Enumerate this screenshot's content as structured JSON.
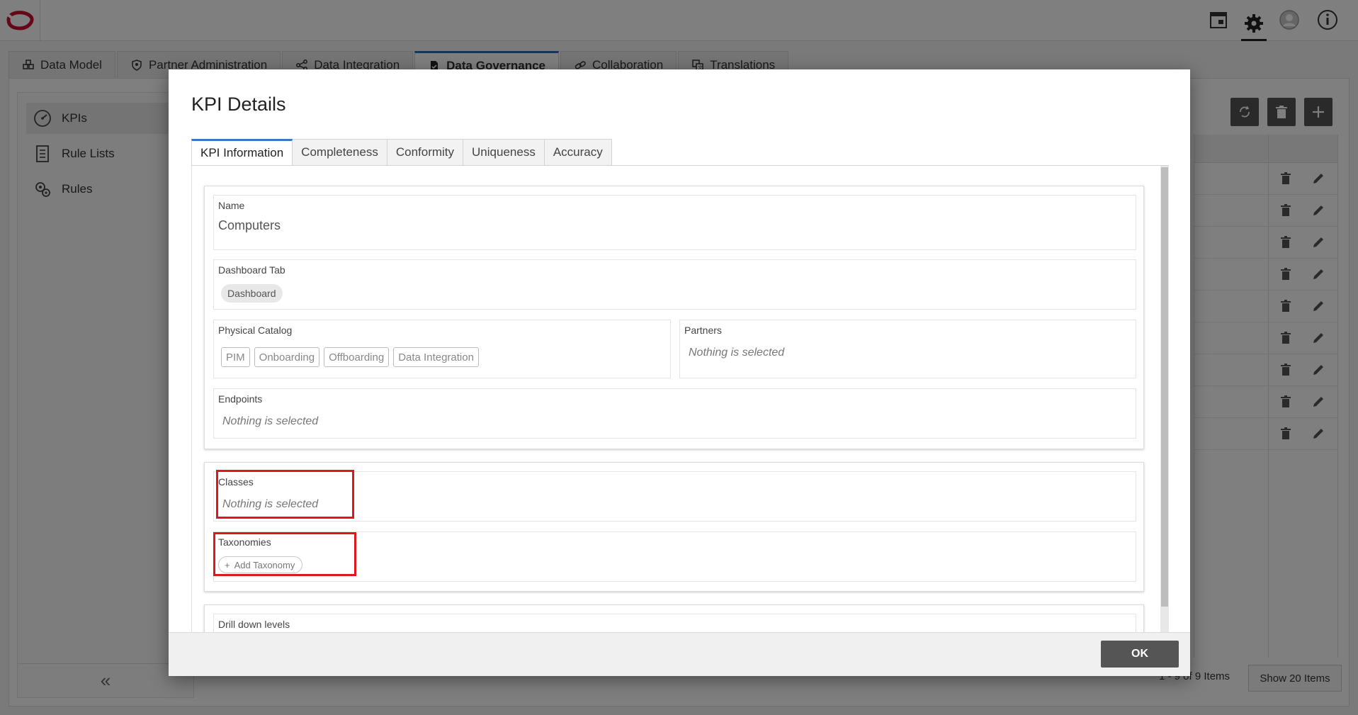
{
  "main_tabs": [
    {
      "label": "Data Model",
      "icon": "cubes-icon"
    },
    {
      "label": "Partner Administration",
      "icon": "shield-icon"
    },
    {
      "label": "Data Integration",
      "icon": "share-nodes-icon"
    },
    {
      "label": "Data Governance",
      "icon": "file-check-icon",
      "active": true
    },
    {
      "label": "Collaboration",
      "icon": "link-icon"
    },
    {
      "label": "Translations",
      "icon": "translate-icon"
    }
  ],
  "sidebar": {
    "items": [
      {
        "label": "KPIs",
        "icon": "speedometer-icon",
        "active": true
      },
      {
        "label": "Rule Lists",
        "icon": "list-document-icon"
      },
      {
        "label": "Rules",
        "icon": "gears-icon"
      }
    ],
    "collapse_glyph": "«"
  },
  "pager": {
    "info": "1 - 9 of 9 Items",
    "page_size_label": "Show 20 Items"
  },
  "modal": {
    "title": "KPI Details",
    "tabs": [
      "KPI Information",
      "Completeness",
      "Conformity",
      "Uniqueness",
      "Accuracy"
    ],
    "active_tab": "KPI Information",
    "fields": {
      "name": {
        "label": "Name",
        "value": "Computers"
      },
      "dashboard_tab": {
        "label": "Dashboard Tab",
        "chip": "Dashboard"
      },
      "physical_catalog": {
        "label": "Physical Catalog",
        "chips": [
          "PIM",
          "Onboarding",
          "Offboarding",
          "Data Integration"
        ]
      },
      "partners": {
        "label": "Partners",
        "empty": "Nothing is selected"
      },
      "endpoints": {
        "label": "Endpoints",
        "empty": "Nothing is selected"
      },
      "classes": {
        "label": "Classes",
        "empty": "Nothing is selected"
      },
      "taxonomies": {
        "label": "Taxonomies",
        "add_label": "Add Taxonomy"
      },
      "drill_down": {
        "label": "Drill down levels"
      }
    },
    "ok_label": "OK"
  },
  "colors": {
    "accent_tab": "#3a77c4",
    "highlight": "#e0161f",
    "logo": "#c8102e",
    "button_dark": "#555555"
  }
}
